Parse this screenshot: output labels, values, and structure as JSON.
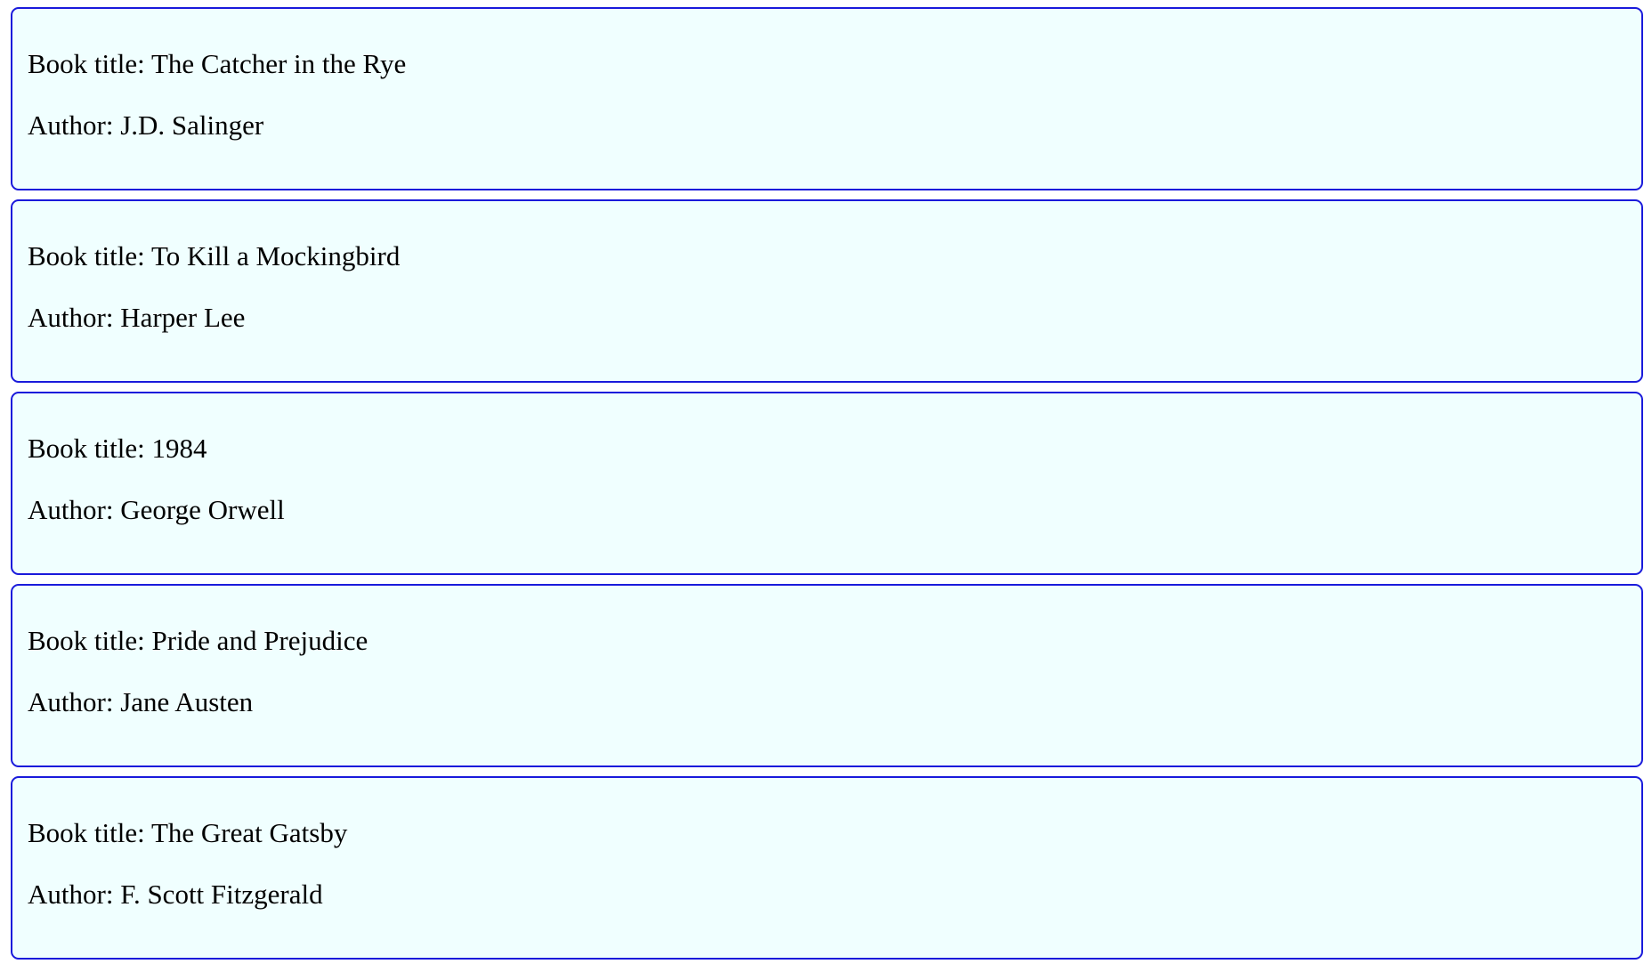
{
  "labels": {
    "title_prefix": "Book title: ",
    "author_prefix": "Author: "
  },
  "colors": {
    "card_background": "#f0ffff",
    "card_border": "#1a1adb",
    "text": "#000000"
  },
  "books": [
    {
      "title": "The Catcher in the Rye",
      "author": "J.D. Salinger"
    },
    {
      "title": "To Kill a Mockingbird",
      "author": "Harper Lee"
    },
    {
      "title": "1984",
      "author": "George Orwell"
    },
    {
      "title": "Pride and Prejudice",
      "author": "Jane Austen"
    },
    {
      "title": "The Great Gatsby",
      "author": "F. Scott Fitzgerald"
    }
  ]
}
